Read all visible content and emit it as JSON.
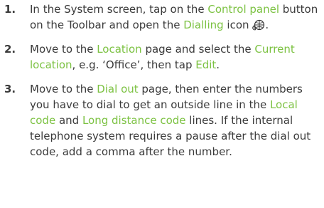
{
  "accent_color": "#7cc242",
  "steps": [
    {
      "number": "1.",
      "t1": "In the System screen, tap on the ",
      "h1": "Control panel",
      "t2": " button on the Toolbar and open the ",
      "h2": "Dialling",
      "t3": " icon",
      "t4": ".",
      "icon": "dialling-icon"
    },
    {
      "number": "2.",
      "t1": "Move to the ",
      "h1": "Location",
      "t2": " page and select the ",
      "h2": "Current location",
      "t3": ", e.g. ‘Office’, then tap ",
      "h3": "Edit",
      "t4": "."
    },
    {
      "number": "3.",
      "t1": "Move to the ",
      "h1": "Dial out",
      "t2": " page, then enter the numbers you have to dial to get an outside line in the ",
      "h2": "Local code",
      "t3": " and ",
      "h3": "Long distance code",
      "t4": " lines. If the internal telephone system requires a pause after the dial out code, add a comma after the number."
    }
  ]
}
